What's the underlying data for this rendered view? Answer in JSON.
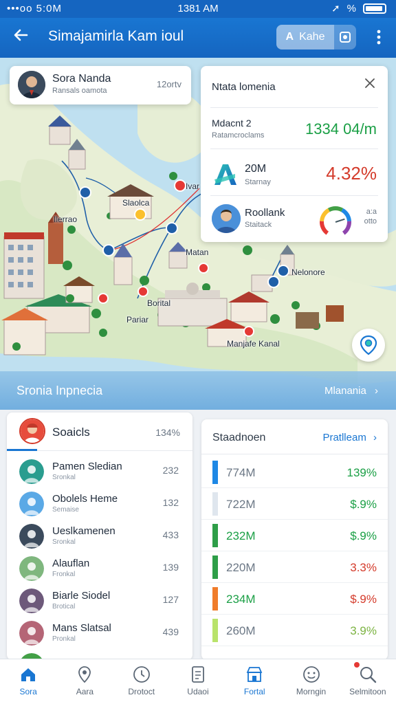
{
  "status_bar": {
    "left": "•••oo 5:0M",
    "time": "1381 AM",
    "right": "%"
  },
  "app_bar": {
    "title": "Simajamirla Kam ioul",
    "pill_label": "Kahe",
    "pill_icon": "A"
  },
  "profile_card": {
    "name": "Sora Nanda",
    "subtitle": "Ransals oamota",
    "time": "12ortv"
  },
  "stats_card": {
    "title": "Ntata lomenia",
    "row1": {
      "label": "Mdacnt 2",
      "sub": "Ratamcroclams",
      "value": "1334 04/m"
    },
    "row2": {
      "label": "20M",
      "sub": "Starnay",
      "value": "4.32%"
    },
    "row3": {
      "label": "Roollank",
      "sub": "Staitack",
      "side_line1": "a:a",
      "side_line2": "otto"
    }
  },
  "gauge": {
    "level": 0.75,
    "colors": [
      "#e53935",
      "#fbc02d",
      "#43a047",
      "#1e88e5",
      "#8e44ad"
    ]
  },
  "map_labels": [
    "Ivar",
    "Slaolca",
    "Ilerrao",
    "Matan",
    "Nelonore",
    "Borital",
    "Pariar",
    "Manjafe Kanal"
  ],
  "banner": {
    "left": "Sronia Inpnecia",
    "right": "Mlanania"
  },
  "left_panel": {
    "title": "Soaicls",
    "percent": "134%",
    "items": [
      {
        "name": "Pamen Sledian",
        "sub": "Sronkal",
        "value": "232",
        "avatar_color": "#2a9d8f"
      },
      {
        "name": "Obolels Heme",
        "sub": "Semaise",
        "value": "132",
        "avatar_color": "#5aa9e6"
      },
      {
        "name": "Ueslkamenen",
        "sub": "Sronkal",
        "value": "433",
        "avatar_color": "#3b4a5c"
      },
      {
        "name": "Alauflan",
        "sub": "Fronkal",
        "value": "139",
        "avatar_color": "#7fb77e"
      },
      {
        "name": "Biarle Siodel",
        "sub": "Brotical",
        "value": "127",
        "avatar_color": "#6d597a"
      },
      {
        "name": "Mans Slatsal",
        "sub": "Pronkal",
        "value": "439",
        "avatar_color": "#b56576"
      },
      {
        "name": "",
        "sub": "",
        "value": "",
        "avatar_color": "#43a047"
      }
    ]
  },
  "right_panel": {
    "title": "Staadnoen",
    "link": "Pratlleam",
    "items": [
      {
        "label": "774M",
        "value": "139%",
        "bar_color": "#1e88e5",
        "label_color": "#6b7785",
        "value_color": "#1a9f45"
      },
      {
        "label": "722M",
        "value": "$.9%",
        "bar_color": "#dfe6ee",
        "label_color": "#6b7785",
        "value_color": "#1a9f45"
      },
      {
        "label": "232M",
        "value": "$.9%",
        "bar_color": "#2e9e48",
        "label_color": "#1a9f45",
        "value_color": "#1a9f45"
      },
      {
        "label": "220M",
        "value": "3.3%",
        "bar_color": "#2e9e48",
        "label_color": "#6b7785",
        "value_color": "#d43b2b"
      },
      {
        "label": "234M",
        "value": "$.9%",
        "bar_color": "#f07c2a",
        "label_color": "#1a9f45",
        "value_color": "#d43b2b"
      },
      {
        "label": "260M",
        "value": "3.9%",
        "bar_color": "#b9e36b",
        "label_color": "#6b7785",
        "value_color": "#7cb342"
      }
    ]
  },
  "bottom_nav": [
    {
      "label": "Sora",
      "icon": "home-icon",
      "active": true
    },
    {
      "label": "Aara",
      "icon": "map-icon",
      "active": false
    },
    {
      "label": "Drotoct",
      "icon": "clock-icon",
      "active": false
    },
    {
      "label": "Udaoi",
      "icon": "document-icon",
      "active": false
    },
    {
      "label": "Fortal",
      "icon": "shop-icon",
      "active": true
    },
    {
      "label": "Morngin",
      "icon": "face-icon",
      "active": false
    },
    {
      "label": "Selmitoon",
      "icon": "search-icon",
      "active": false
    }
  ]
}
